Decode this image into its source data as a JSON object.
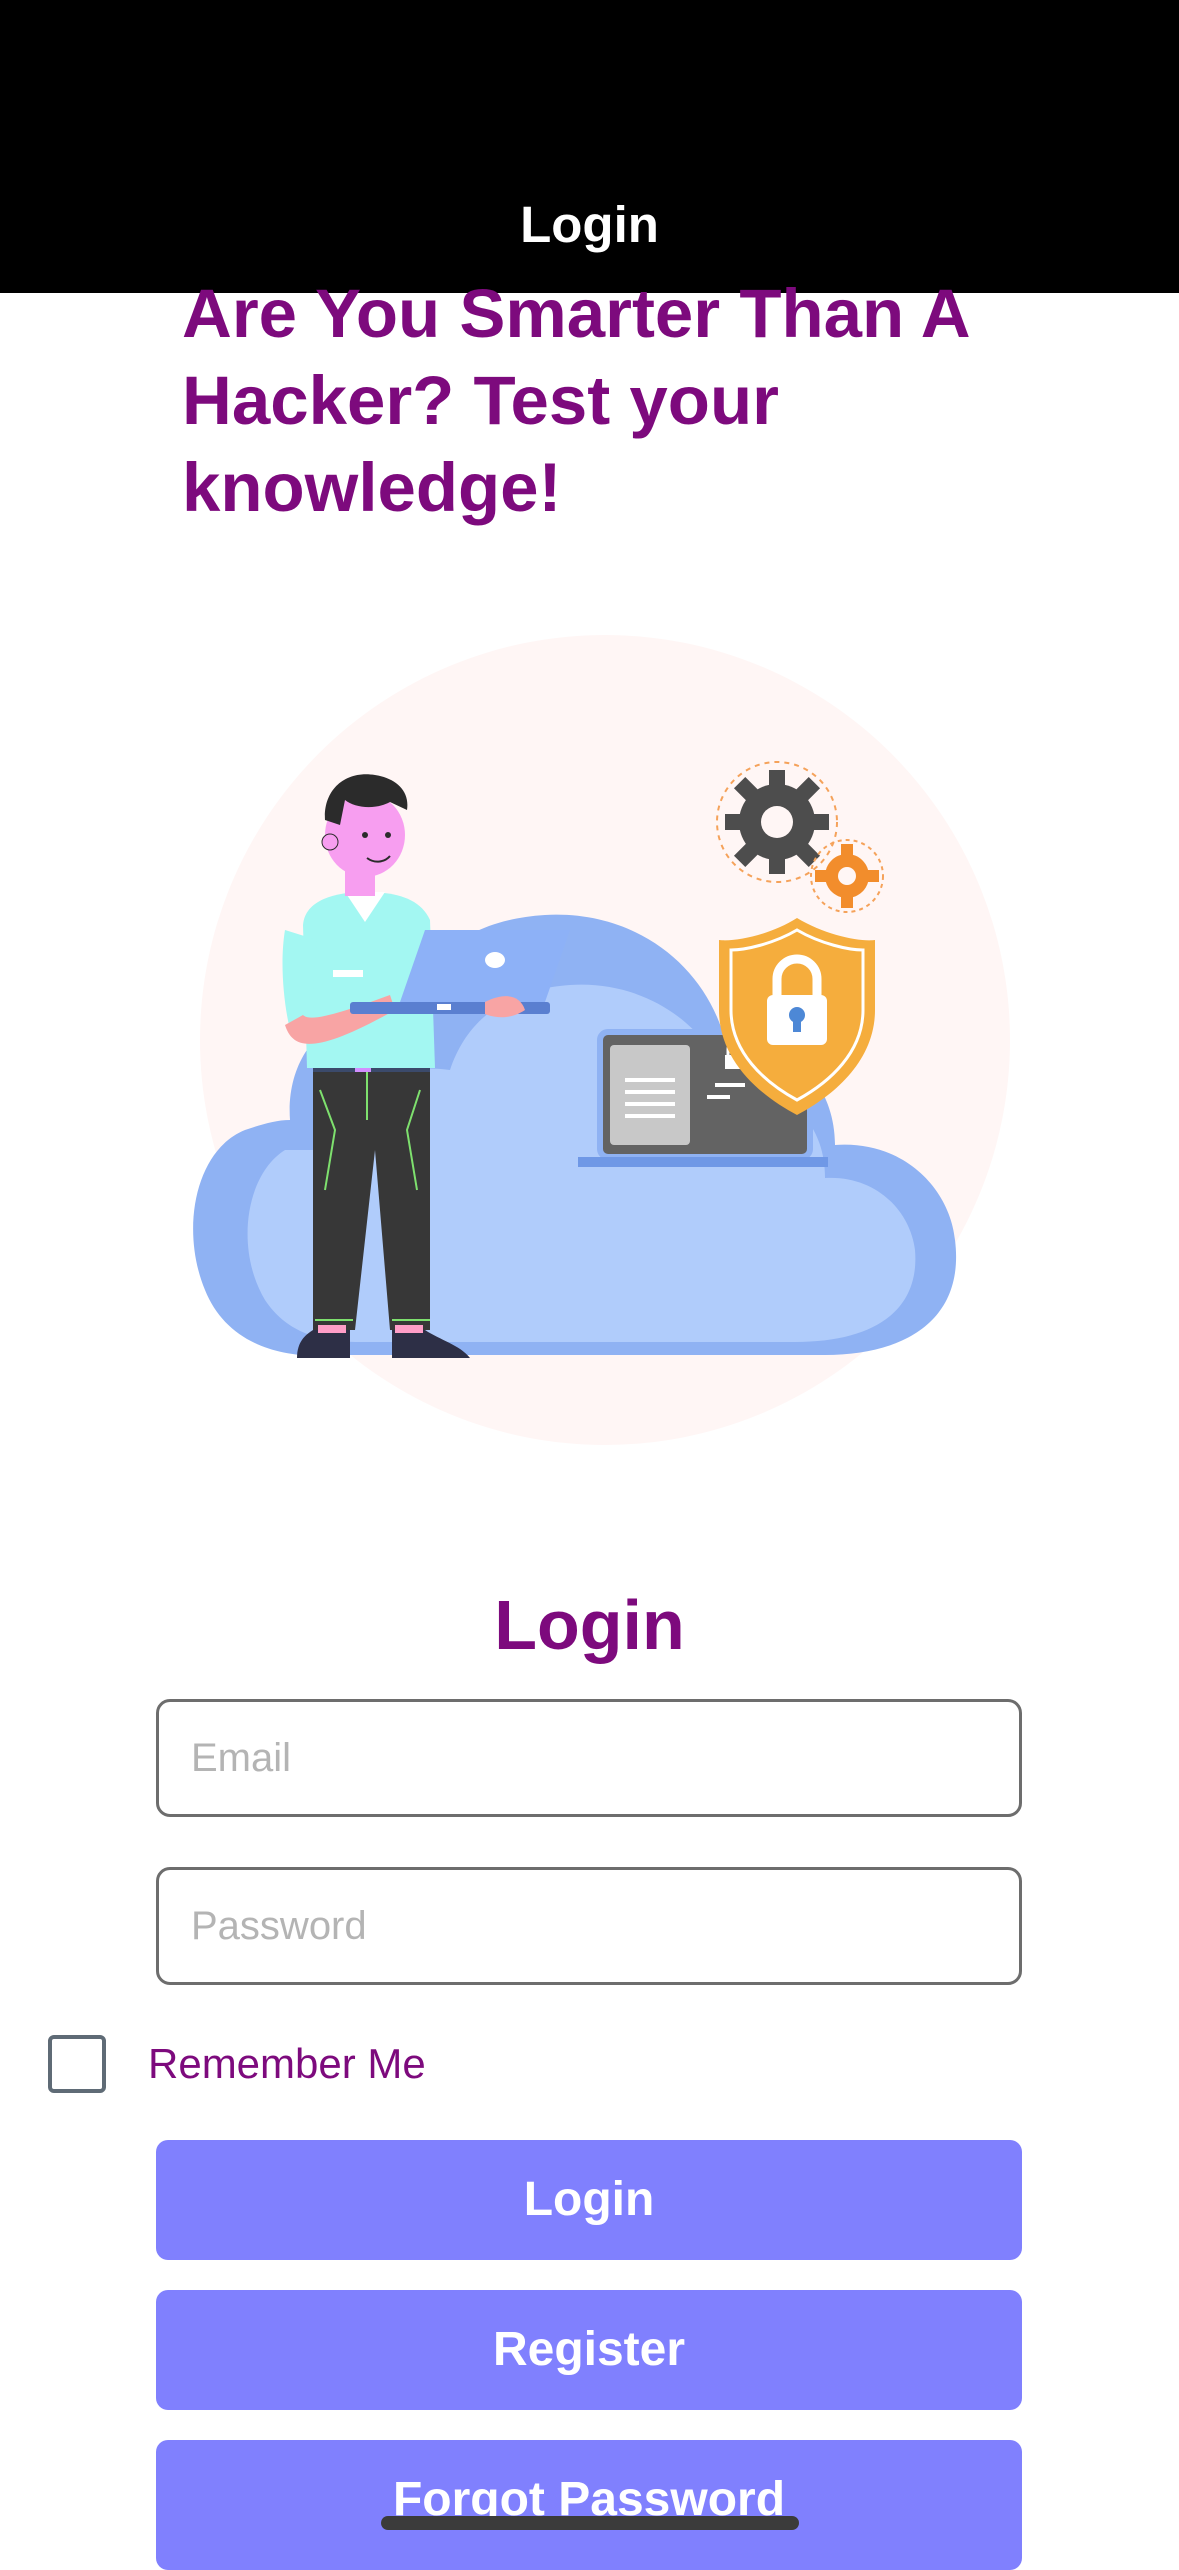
{
  "nav": {
    "title": "Login"
  },
  "headline": "Are You Smarter Than A Hacker? Test your knowledge!",
  "hero": {
    "icon": "cloud-security-illustration"
  },
  "form": {
    "heading": "Login",
    "email_placeholder": "Email",
    "password_placeholder": "Password",
    "remember_label": "Remember Me",
    "remember_checked": false
  },
  "buttons": {
    "login": "Login",
    "register": "Register",
    "forgot": "Forgot Password"
  },
  "colors": {
    "header_bg": "#000000",
    "accent_purple": "#7d0a7d",
    "button": "#8080fe"
  }
}
